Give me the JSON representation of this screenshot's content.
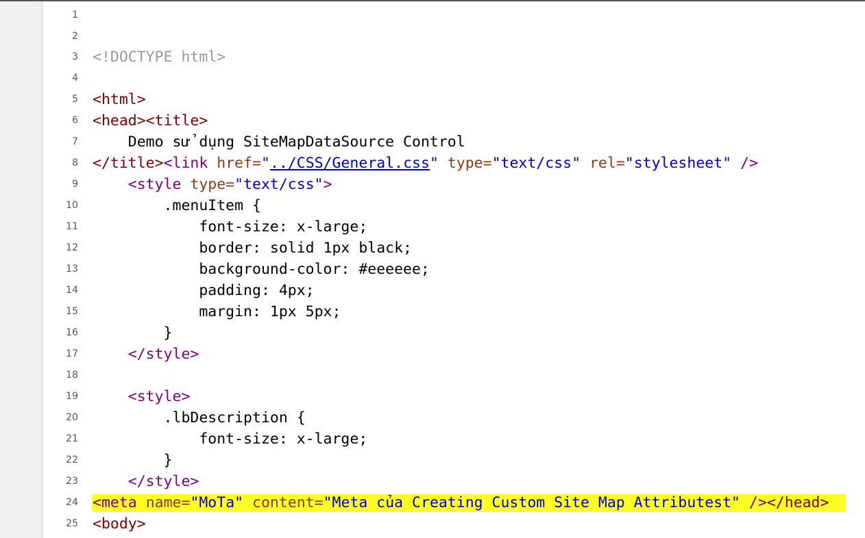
{
  "editor": {
    "line_numbers": [
      "1",
      "2",
      "3",
      "4",
      "5",
      "6",
      "7",
      "8",
      "9",
      "10",
      "11",
      "12",
      "13",
      "14",
      "15",
      "16",
      "17",
      "18",
      "19",
      "20",
      "21",
      "22",
      "23",
      "24",
      "25"
    ],
    "lines": {
      "l3": {
        "doctype": "<!DOCTYPE html>"
      },
      "l5": {
        "html_open": "<html>"
      },
      "l6": {
        "head_open": "<head>",
        "title_open": "<title>"
      },
      "l7": {
        "text": "    Demo sử dụng SiteMapDataSource Control"
      },
      "l8": {
        "title_close": "</title>",
        "link_open": "<link",
        "sp1": " ",
        "href_attr": "href=",
        "q1": "\"",
        "href_value": "../CSS/General.css",
        "q2": "\"",
        "sp2": " ",
        "type_attr": "type=",
        "type_value": "\"text/css\"",
        "sp3": " ",
        "rel_attr": "rel=",
        "rel_value": "\"stylesheet\"",
        "close": " />"
      },
      "l9": {
        "indent": "    ",
        "style_open": "<style",
        "sp": " ",
        "type_attr": "type=",
        "type_value": "\"text/css\"",
        "close": ">"
      },
      "l10": {
        "text": "        .menuItem {"
      },
      "l11": {
        "text": "            font-size: x-large;"
      },
      "l12": {
        "text": "            border: solid 1px black;"
      },
      "l13": {
        "text": "            background-color: #eeeeee;"
      },
      "l14": {
        "text": "            padding: 4px;"
      },
      "l15": {
        "text": "            margin: 1px 5px;"
      },
      "l16": {
        "text": "        }"
      },
      "l17": {
        "indent": "    ",
        "tag": "</style>"
      },
      "l19": {
        "indent": "    ",
        "tag": "<style>"
      },
      "l20": {
        "text": "        .lbDescription {"
      },
      "l21": {
        "text": "            font-size: x-large;"
      },
      "l22": {
        "text": "        }"
      },
      "l23": {
        "indent": "    ",
        "tag": "</style>"
      },
      "l24": {
        "meta_open": "<meta",
        "sp1": " ",
        "name_attr": "name=",
        "name_value": "\"MoTa\"",
        "sp2": " ",
        "content_attr": "content=",
        "content_value": "\"Meta của Creating Custom Site Map Attributest\"",
        "close": " />",
        "head_close": "</head>"
      },
      "l25": {
        "body_open": "<body>"
      }
    }
  },
  "colors": {
    "tag": "#800000",
    "tag_purple": "#800080",
    "attribute": "#8b3a1a",
    "value": "#0000cc",
    "doctype": "#9a9a9a",
    "highlight": "#ffff26",
    "gutter_bg": "#f0f0f0"
  }
}
